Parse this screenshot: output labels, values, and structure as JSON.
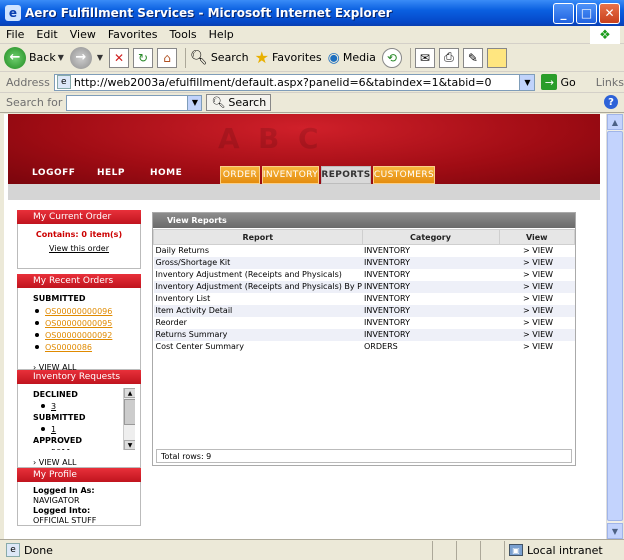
{
  "window": {
    "title": "Aero Fulfillment Services - Microsoft Internet Explorer"
  },
  "menu": [
    "File",
    "Edit",
    "View",
    "Favorites",
    "Tools",
    "Help"
  ],
  "toolbar": {
    "back": "Back",
    "search": "Search",
    "favorites": "Favorites",
    "media": "Media"
  },
  "address": {
    "label": "Address",
    "url": "http://web2003a/efulfillment/default.aspx?panelid=6&tabindex=1&tabid=0",
    "go": "Go",
    "links": "Links"
  },
  "searchbar": {
    "label": "Search for",
    "button": "Search"
  },
  "site": {
    "nav": [
      "LOGOFF",
      "HELP",
      "HOME"
    ],
    "tabs": [
      "ORDER",
      "INVENTORY",
      "REPORTS",
      "CUSTOMERS"
    ],
    "active_tab": "REPORTS"
  },
  "sidebar": {
    "current_order": {
      "title": "My Current Order",
      "contains": "Contains: 0 item(s)",
      "view_link": "View this order"
    },
    "recent_orders": {
      "title": "My Recent Orders",
      "status": "SUBMITTED",
      "orders": [
        "OS00000000096",
        "OS00000000095",
        "OS00000000092",
        "OS0000086"
      ],
      "view_all": "VIEW ALL"
    },
    "inventory_requests": {
      "title": "Inventory Requests",
      "groups": [
        {
          "label": "DECLINED",
          "value": "3"
        },
        {
          "label": "SUBMITTED",
          "value": "1"
        },
        {
          "label": "APPROVED",
          "value": "5011"
        }
      ],
      "view_all": "VIEW ALL"
    },
    "profile": {
      "title": "My Profile",
      "logged_in_as_label": "Logged In As:",
      "logged_in_as": "NAVIGATOR",
      "logged_into_label": "Logged Into:",
      "logged_into": "OFFICIAL STUFF"
    }
  },
  "reports": {
    "title": "View Reports",
    "columns": [
      "Report",
      "Category",
      "View"
    ],
    "rows": [
      {
        "report": "Daily Returns",
        "category": "INVENTORY",
        "view": "> VIEW"
      },
      {
        "report": "Gross/Shortage Kit",
        "category": "INVENTORY",
        "view": "> VIEW"
      },
      {
        "report": "Inventory Adjustment (Receipts and Physicals)",
        "category": "INVENTORY",
        "view": "> VIEW"
      },
      {
        "report": "Inventory Adjustment (Receipts and Physicals) By P",
        "category": "INVENTORY",
        "view": "> VIEW"
      },
      {
        "report": "Inventory List",
        "category": "INVENTORY",
        "view": "> VIEW"
      },
      {
        "report": "Item Activity Detail",
        "category": "INVENTORY",
        "view": "> VIEW"
      },
      {
        "report": "Reorder",
        "category": "INVENTORY",
        "view": "> VIEW"
      },
      {
        "report": "Returns Summary",
        "category": "INVENTORY",
        "view": "> VIEW"
      },
      {
        "report": "Cost Center Summary",
        "category": "ORDERS",
        "view": "> VIEW"
      }
    ],
    "total_rows": "Total rows: 9"
  },
  "status": {
    "text": "Done",
    "zone": "Local intranet"
  }
}
